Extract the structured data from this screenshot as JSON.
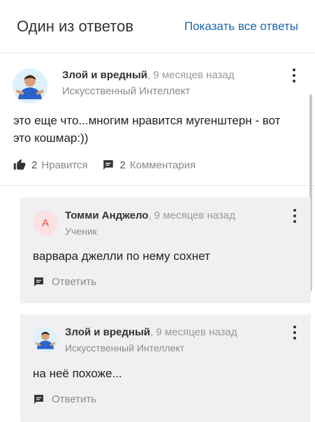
{
  "header": {
    "title": "Один из ответов",
    "show_all_label": "Показать все ответы"
  },
  "answer": {
    "author_name": "Злой и вредный",
    "time": ", 9 месяцев назад",
    "rank": "Искусственный Интеллект",
    "text": "это еще что...многим нравится мугенштерн - вот это кошмар:))",
    "likes_count": "2",
    "likes_label": "Нравится",
    "comments_count": "2",
    "comments_label": "Комментария"
  },
  "comments": [
    {
      "avatar_letter": "А",
      "author_name": "Томми Анджело",
      "time": ", 9 месяцев назад",
      "rank": "Ученик",
      "text": "варвара джелли по нему сохнет",
      "reply_label": "Ответить"
    },
    {
      "author_name": "Злой и вредный",
      "time": ", 9 месяцев назад",
      "rank": "Искусственный Интеллект",
      "text": "на неё похоже...",
      "reply_label": "Ответить"
    }
  ],
  "colors": {
    "link": "#1a66b3",
    "comment_bg": "#f0f0f2",
    "letter_avatar_bg": "#fbe1e1",
    "letter_avatar_fg": "#e84a4a"
  }
}
